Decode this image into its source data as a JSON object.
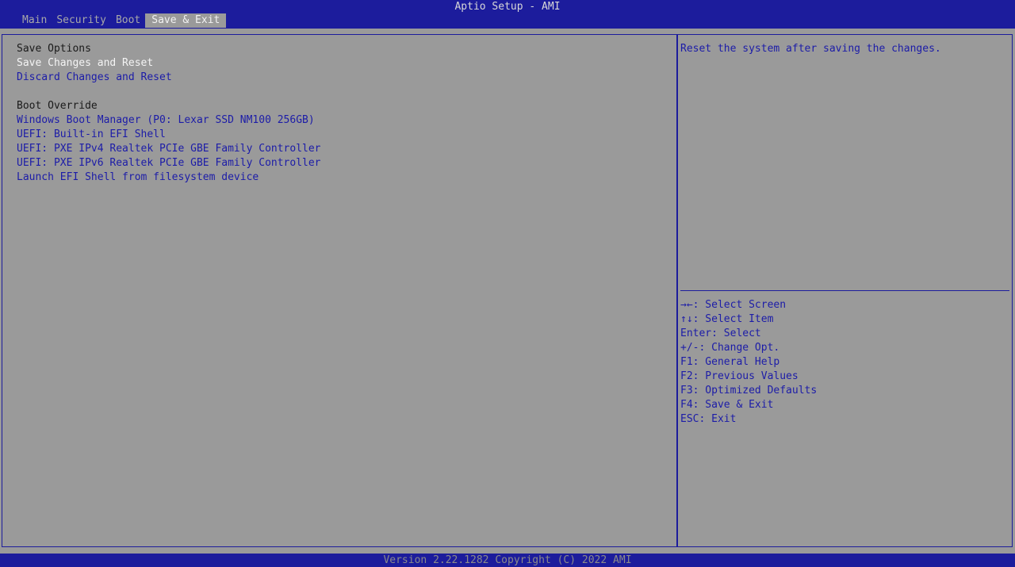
{
  "header": {
    "title": "Aptio Setup - AMI",
    "tabs": [
      {
        "label": "Main"
      },
      {
        "label": "Security"
      },
      {
        "label": "Boot"
      },
      {
        "label": "Save & Exit",
        "active": true
      }
    ]
  },
  "main": {
    "save_options_heading": "Save Options",
    "save_options": [
      {
        "label": "Save Changes and Reset",
        "selected": true
      },
      {
        "label": "Discard Changes and Reset"
      }
    ],
    "boot_override_heading": "Boot Override",
    "boot_override": [
      {
        "label": "Windows Boot Manager (P0: Lexar SSD NM100 256GB)"
      },
      {
        "label": "UEFI: Built-in EFI Shell"
      },
      {
        "label": "UEFI: PXE IPv4 Realtek PCIe GBE Family Controller"
      },
      {
        "label": "UEFI: PXE IPv6 Realtek PCIe GBE Family Controller"
      },
      {
        "label": "Launch EFI Shell from filesystem device"
      }
    ]
  },
  "help": {
    "text": "Reset the system after saving the changes.",
    "keys": [
      "→←: Select Screen",
      "↑↓: Select Item",
      "Enter: Select",
      "+/-: Change Opt.",
      "F1: General Help",
      "F2: Previous Values",
      "F3: Optimized Defaults",
      "F4: Save & Exit",
      "ESC: Exit"
    ]
  },
  "footer": {
    "version": "Version 2.22.1282 Copyright (C) 2022 AMI"
  },
  "colors": {
    "bar_blue": "#1c1c9c",
    "background_gray": "#9a9a9a",
    "item_blue": "#1c1ca8",
    "selected_white": "#f4f4f4"
  }
}
